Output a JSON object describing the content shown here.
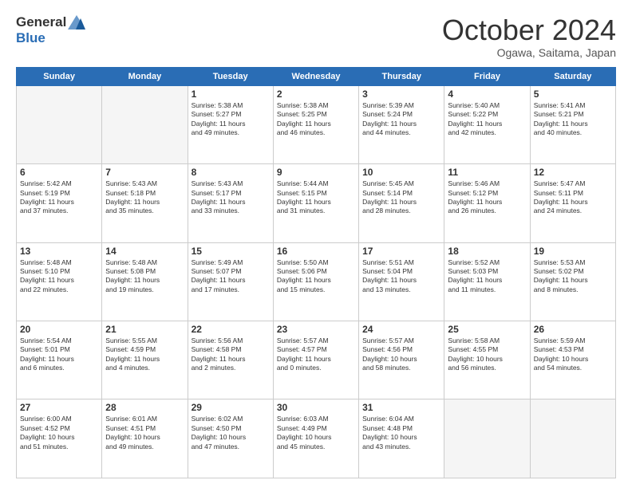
{
  "logo": {
    "general": "General",
    "blue": "Blue"
  },
  "header": {
    "month": "October 2024",
    "location": "Ogawa, Saitama, Japan"
  },
  "weekdays": [
    "Sunday",
    "Monday",
    "Tuesday",
    "Wednesday",
    "Thursday",
    "Friday",
    "Saturday"
  ],
  "weeks": [
    [
      {
        "day": "",
        "info": ""
      },
      {
        "day": "",
        "info": ""
      },
      {
        "day": "1",
        "info": "Sunrise: 5:38 AM\nSunset: 5:27 PM\nDaylight: 11 hours\nand 49 minutes."
      },
      {
        "day": "2",
        "info": "Sunrise: 5:38 AM\nSunset: 5:25 PM\nDaylight: 11 hours\nand 46 minutes."
      },
      {
        "day": "3",
        "info": "Sunrise: 5:39 AM\nSunset: 5:24 PM\nDaylight: 11 hours\nand 44 minutes."
      },
      {
        "day": "4",
        "info": "Sunrise: 5:40 AM\nSunset: 5:22 PM\nDaylight: 11 hours\nand 42 minutes."
      },
      {
        "day": "5",
        "info": "Sunrise: 5:41 AM\nSunset: 5:21 PM\nDaylight: 11 hours\nand 40 minutes."
      }
    ],
    [
      {
        "day": "6",
        "info": "Sunrise: 5:42 AM\nSunset: 5:19 PM\nDaylight: 11 hours\nand 37 minutes."
      },
      {
        "day": "7",
        "info": "Sunrise: 5:43 AM\nSunset: 5:18 PM\nDaylight: 11 hours\nand 35 minutes."
      },
      {
        "day": "8",
        "info": "Sunrise: 5:43 AM\nSunset: 5:17 PM\nDaylight: 11 hours\nand 33 minutes."
      },
      {
        "day": "9",
        "info": "Sunrise: 5:44 AM\nSunset: 5:15 PM\nDaylight: 11 hours\nand 31 minutes."
      },
      {
        "day": "10",
        "info": "Sunrise: 5:45 AM\nSunset: 5:14 PM\nDaylight: 11 hours\nand 28 minutes."
      },
      {
        "day": "11",
        "info": "Sunrise: 5:46 AM\nSunset: 5:12 PM\nDaylight: 11 hours\nand 26 minutes."
      },
      {
        "day": "12",
        "info": "Sunrise: 5:47 AM\nSunset: 5:11 PM\nDaylight: 11 hours\nand 24 minutes."
      }
    ],
    [
      {
        "day": "13",
        "info": "Sunrise: 5:48 AM\nSunset: 5:10 PM\nDaylight: 11 hours\nand 22 minutes."
      },
      {
        "day": "14",
        "info": "Sunrise: 5:48 AM\nSunset: 5:08 PM\nDaylight: 11 hours\nand 19 minutes."
      },
      {
        "day": "15",
        "info": "Sunrise: 5:49 AM\nSunset: 5:07 PM\nDaylight: 11 hours\nand 17 minutes."
      },
      {
        "day": "16",
        "info": "Sunrise: 5:50 AM\nSunset: 5:06 PM\nDaylight: 11 hours\nand 15 minutes."
      },
      {
        "day": "17",
        "info": "Sunrise: 5:51 AM\nSunset: 5:04 PM\nDaylight: 11 hours\nand 13 minutes."
      },
      {
        "day": "18",
        "info": "Sunrise: 5:52 AM\nSunset: 5:03 PM\nDaylight: 11 hours\nand 11 minutes."
      },
      {
        "day": "19",
        "info": "Sunrise: 5:53 AM\nSunset: 5:02 PM\nDaylight: 11 hours\nand 8 minutes."
      }
    ],
    [
      {
        "day": "20",
        "info": "Sunrise: 5:54 AM\nSunset: 5:01 PM\nDaylight: 11 hours\nand 6 minutes."
      },
      {
        "day": "21",
        "info": "Sunrise: 5:55 AM\nSunset: 4:59 PM\nDaylight: 11 hours\nand 4 minutes."
      },
      {
        "day": "22",
        "info": "Sunrise: 5:56 AM\nSunset: 4:58 PM\nDaylight: 11 hours\nand 2 minutes."
      },
      {
        "day": "23",
        "info": "Sunrise: 5:57 AM\nSunset: 4:57 PM\nDaylight: 11 hours\nand 0 minutes."
      },
      {
        "day": "24",
        "info": "Sunrise: 5:57 AM\nSunset: 4:56 PM\nDaylight: 10 hours\nand 58 minutes."
      },
      {
        "day": "25",
        "info": "Sunrise: 5:58 AM\nSunset: 4:55 PM\nDaylight: 10 hours\nand 56 minutes."
      },
      {
        "day": "26",
        "info": "Sunrise: 5:59 AM\nSunset: 4:53 PM\nDaylight: 10 hours\nand 54 minutes."
      }
    ],
    [
      {
        "day": "27",
        "info": "Sunrise: 6:00 AM\nSunset: 4:52 PM\nDaylight: 10 hours\nand 51 minutes."
      },
      {
        "day": "28",
        "info": "Sunrise: 6:01 AM\nSunset: 4:51 PM\nDaylight: 10 hours\nand 49 minutes."
      },
      {
        "day": "29",
        "info": "Sunrise: 6:02 AM\nSunset: 4:50 PM\nDaylight: 10 hours\nand 47 minutes."
      },
      {
        "day": "30",
        "info": "Sunrise: 6:03 AM\nSunset: 4:49 PM\nDaylight: 10 hours\nand 45 minutes."
      },
      {
        "day": "31",
        "info": "Sunrise: 6:04 AM\nSunset: 4:48 PM\nDaylight: 10 hours\nand 43 minutes."
      },
      {
        "day": "",
        "info": ""
      },
      {
        "day": "",
        "info": ""
      }
    ]
  ]
}
